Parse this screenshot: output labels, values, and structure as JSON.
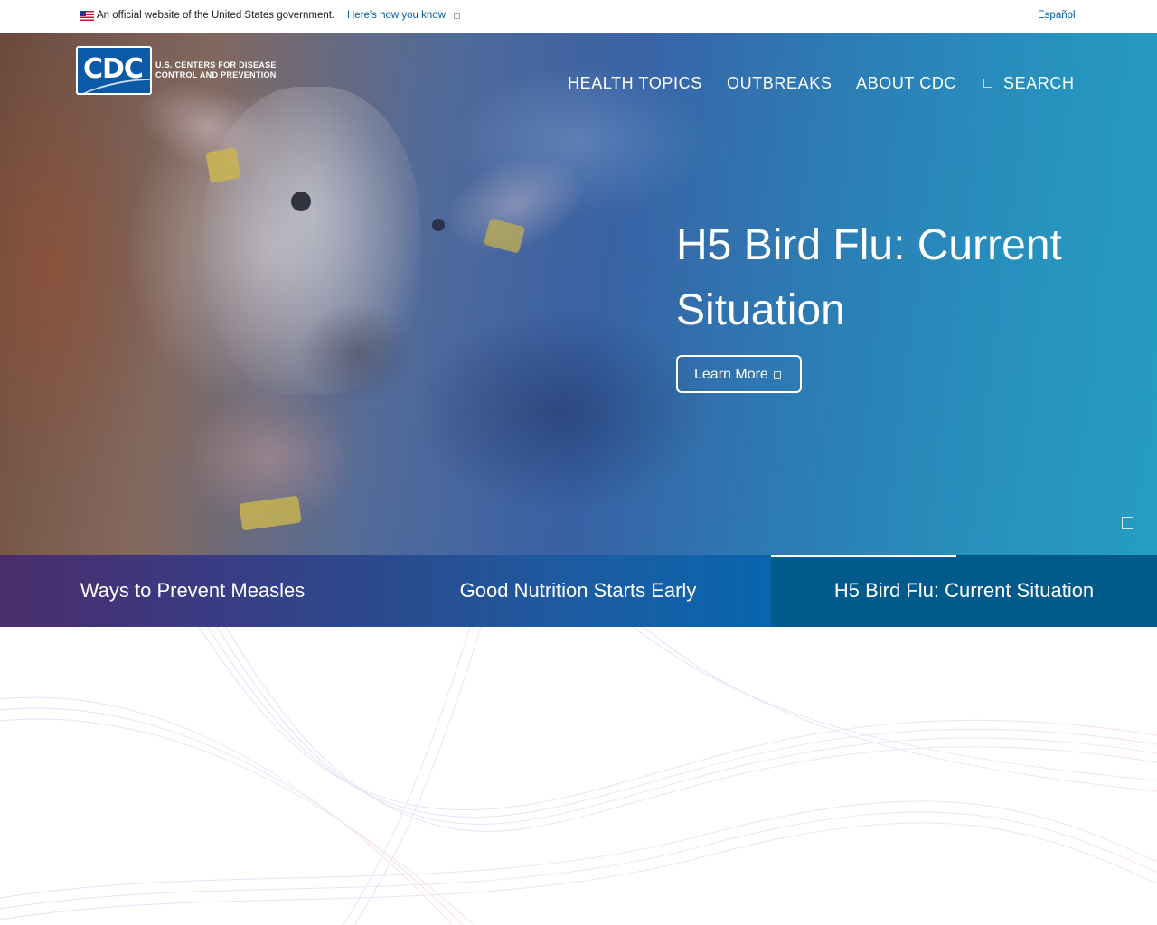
{
  "gov_banner": {
    "text": "An official website of the United States government.",
    "link": "Here's how you know",
    "language": "Español"
  },
  "header": {
    "logo_text": "CDC",
    "org_line1": "U.S. CENTERS FOR DISEASE",
    "org_line2": "CONTROL AND PREVENTION",
    "nav": [
      "HEALTH TOPICS",
      "OUTBREAKS",
      "ABOUT CDC",
      "SEARCH"
    ]
  },
  "hero": {
    "title": "H5 Bird Flu: Current Situation",
    "button": "Learn More"
  },
  "tabs": [
    {
      "label": "Ways to Prevent Measles",
      "active": false
    },
    {
      "label": "Good Nutrition Starts Early",
      "active": false
    },
    {
      "label": "H5 Bird Flu: Current Situation",
      "active": true
    }
  ],
  "colors": {
    "link": "#005ea2",
    "logo_blue": "#0a5aa8",
    "active_tab": "#005a8c"
  }
}
